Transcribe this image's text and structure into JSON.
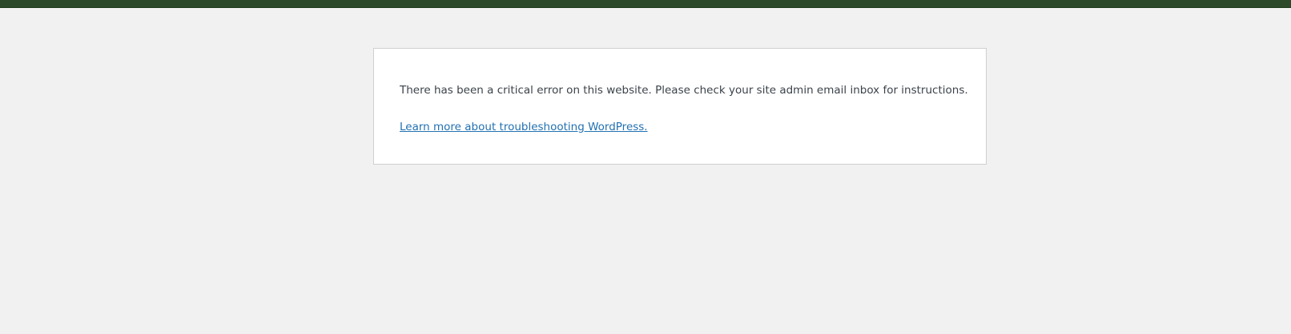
{
  "theme": {
    "top_bar_color": "#2c4a2a",
    "page_background": "#f1f1f1",
    "link_color": "#2271b1",
    "text_color": "#3c434a"
  },
  "error": {
    "message": "There has been a critical error on this website. Please check your site admin email inbox for instructions.",
    "link_text": "Learn more about troubleshooting WordPress."
  }
}
